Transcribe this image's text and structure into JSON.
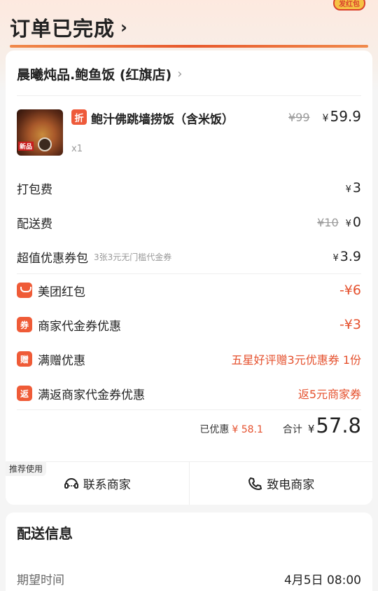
{
  "header": {
    "title": "订单已完成",
    "chevron": "›",
    "badge": "发红包"
  },
  "shop": {
    "name": "晨曦炖品.鲍鱼饭 (红旗店)",
    "chevron": "›"
  },
  "item": {
    "image_tag": "新品",
    "discount_tag": "折",
    "name": "鲍汁佛跳墙捞饭（含米饭）",
    "original_price": "¥99",
    "yen": "¥",
    "price": "59.9",
    "qty": "x1"
  },
  "fees": [
    {
      "label": "打包费",
      "amount_yen": "¥",
      "amount": "3"
    },
    {
      "label": "配送费",
      "strike": "¥10",
      "amount_yen": "¥",
      "amount": "0"
    },
    {
      "label": "超值优惠券包",
      "sub": "3张3元无门槛代金券",
      "amount_yen": "¥",
      "amount": "3.9"
    }
  ],
  "discounts": [
    {
      "icon": "red-packet-icon",
      "icon_char": "",
      "label": "美团红包",
      "amount": "-¥6"
    },
    {
      "icon": "coupon-icon",
      "icon_char": "券",
      "label": "商家代金券优惠",
      "amount": "-¥3"
    },
    {
      "icon": "gift-icon",
      "icon_char": "赠",
      "label": "满赠优惠",
      "amount": "五星好评赠3元优惠券 1份"
    },
    {
      "icon": "return-icon",
      "icon_char": "返",
      "label": "满返商家代金券优惠",
      "amount": "返5元商家券"
    }
  ],
  "total": {
    "discount_label": "已优惠",
    "discount_value": "¥ 58.1",
    "sum_label": "合计",
    "sum_yen": "¥",
    "sum_value": "57.8"
  },
  "actions": {
    "recommend_tag": "推荐使用",
    "contact_label": "联系商家",
    "call_label": "致电商家"
  },
  "delivery": {
    "title": "配送信息",
    "expected_label": "期望时间",
    "expected_value": "4月5日 08:00"
  },
  "colors": {
    "accent": "#ef5b37",
    "price_red": "#e5512e"
  }
}
